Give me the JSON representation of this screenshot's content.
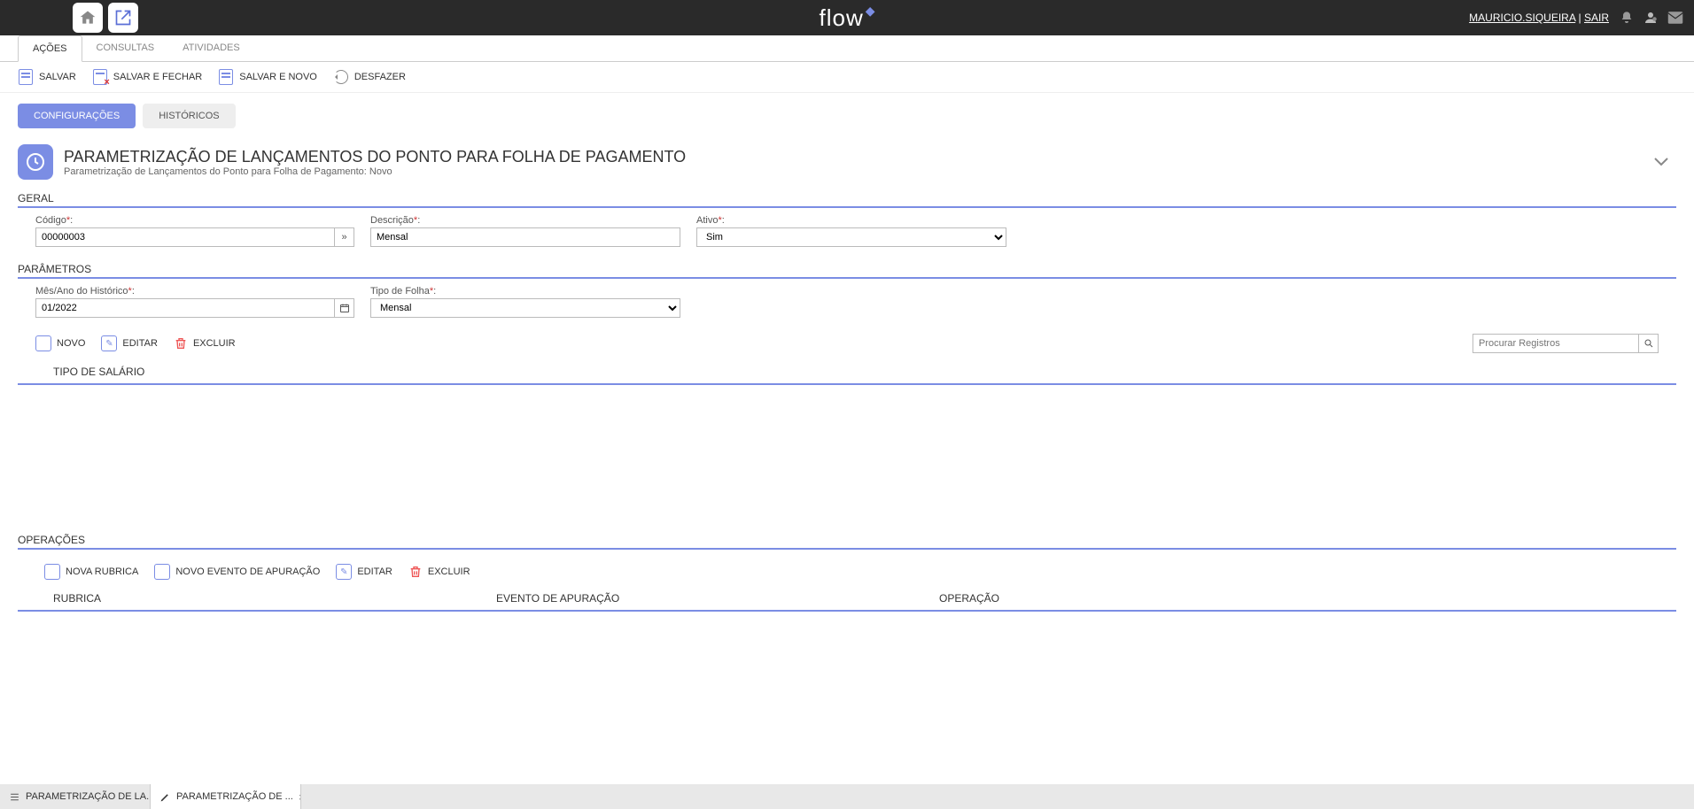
{
  "topbar": {
    "logo": "flow",
    "user": "MAURICIO.SIQUEIRA",
    "separator": " | ",
    "logout": "SAIR"
  },
  "nav": {
    "tabs": [
      "AÇÕES",
      "CONSULTAS",
      "ATIVIDADES"
    ]
  },
  "toolbar": {
    "salvar": "SALVAR",
    "salvar_fechar": "SALVAR E FECHAR",
    "salvar_novo": "SALVAR E NOVO",
    "desfazer": "DESFAZER"
  },
  "subtabs": {
    "config": "CONFIGURAÇÕES",
    "historicos": "HISTÓRICOS"
  },
  "page": {
    "title": "PARAMETRIZAÇÃO DE LANÇAMENTOS DO PONTO PARA FOLHA DE PAGAMENTO",
    "subtitle": "Parametrização de Lançamentos do Ponto para Folha de Pagamento: Novo"
  },
  "sections": {
    "geral": "GERAL",
    "parametros": "PARÂMETROS",
    "tipo_salario": "TIPO DE SALÁRIO",
    "operacoes": "OPERAÇÕES"
  },
  "fields": {
    "codigo": {
      "label": "Código",
      "value": "00000003"
    },
    "descricao": {
      "label": "Descrição",
      "value": "Mensal"
    },
    "ativo": {
      "label": "Ativo",
      "value": "Sim"
    },
    "mes_ano": {
      "label": "Mês/Ano do Histórico",
      "value": "01/2022"
    },
    "tipo_folha": {
      "label": "Tipo de Folha",
      "value": "Mensal"
    }
  },
  "grid": {
    "novo": "NOVO",
    "editar": "EDITAR",
    "excluir": "EXCLUIR",
    "search_placeholder": "Procurar Registros"
  },
  "operacoes_toolbar": {
    "nova_rubrica": "NOVA RUBRICA",
    "novo_evento": "NOVO EVENTO DE APURAÇÃO",
    "editar": "EDITAR",
    "excluir": "EXCLUIR"
  },
  "operacoes_cols": {
    "rubrica": "RUBRICA",
    "evento": "EVENTO DE APURAÇÃO",
    "operacao": "OPERAÇÃO"
  },
  "bottom_tabs": {
    "tab1": "PARAMETRIZAÇÃO DE LA...",
    "tab2": "PARAMETRIZAÇÃO DE ..."
  }
}
